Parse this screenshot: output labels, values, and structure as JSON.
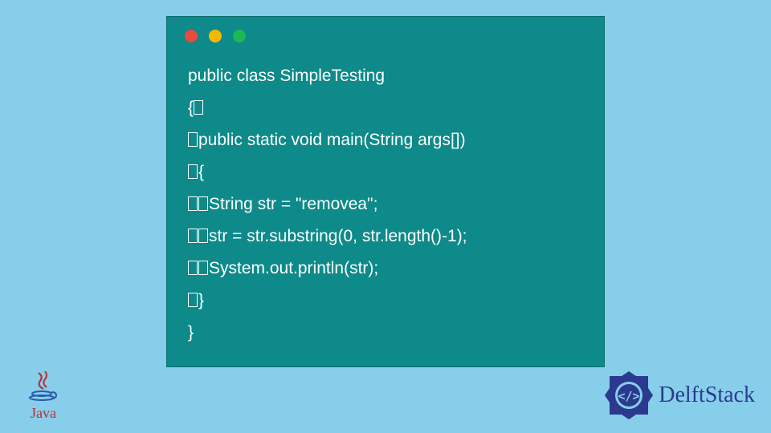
{
  "code": {
    "lines": [
      "public class SimpleTesting",
      "{",
      "public static void main(String args[])",
      "{",
      "String str = \"removea\";",
      "str = str.substring(0, str.length()-1);",
      "System.out.println(str);",
      "}",
      "}"
    ],
    "indents": [
      0,
      0,
      1,
      1,
      2,
      2,
      2,
      1,
      0
    ],
    "trailing_tofu": [
      false,
      true,
      false,
      false,
      false,
      false,
      false,
      false,
      false
    ]
  },
  "window": {
    "dots": [
      "red",
      "yellow",
      "green"
    ]
  },
  "logos": {
    "java_label": "Java",
    "delft_label": "DelftStack"
  },
  "colors": {
    "bg": "#87ceeb",
    "window": "#0e8a8a",
    "code_text": "#ffffff",
    "java_red": "#b8312f",
    "delft_blue": "#2b3a8f"
  }
}
